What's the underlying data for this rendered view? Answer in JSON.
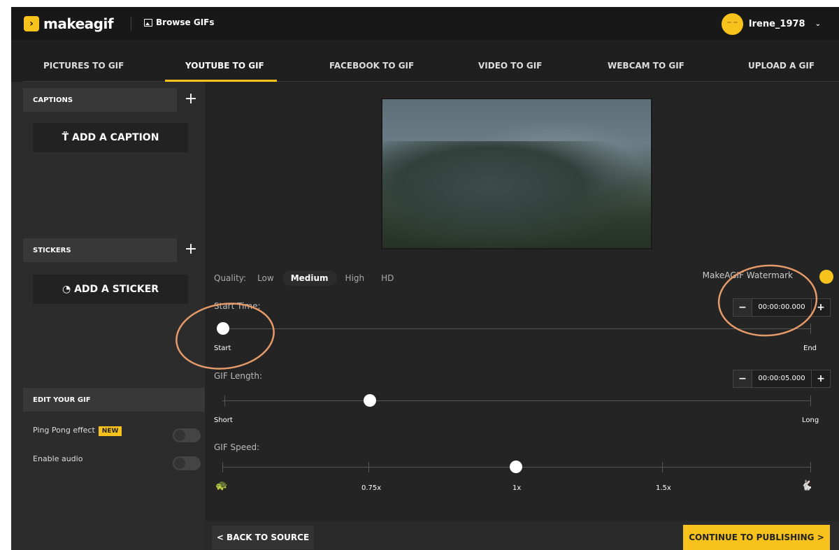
{
  "header": {
    "logo_text": "makeagif",
    "browse_label": "Browse GIFs",
    "username": "Irene_1978",
    "user_chevron": "⌄"
  },
  "tabs": [
    {
      "label": "PICTURES TO GIF"
    },
    {
      "label": "YOUTUBE TO GIF"
    },
    {
      "label": "FACEBOOK TO GIF"
    },
    {
      "label": "VIDEO TO GIF"
    },
    {
      "label": "WEBCAM TO GIF"
    },
    {
      "label": "UPLOAD A GIF"
    }
  ],
  "active_tab": "YOUTUBE TO GIF",
  "sidebar": {
    "captions_title": "CAPTIONS",
    "add_caption": "ADD A CAPTION",
    "stickers_title": "STICKERS",
    "add_sticker": "ADD A STICKER",
    "edit_title": "EDIT YOUR GIF",
    "ping_pong_label": "Ping Pong effect",
    "new_badge": "NEW",
    "audio_label": "Enable audio",
    "plus": "+"
  },
  "quality": {
    "label": "Quality:",
    "options": [
      "Low",
      "Medium",
      "High",
      "HD"
    ],
    "selected": "Medium"
  },
  "watermark_label": "MakeAGIF Watermark",
  "start_time": {
    "label": "Start Time:",
    "value": "00:00:00.000",
    "left_label": "Start",
    "right_label": "End",
    "position": 0
  },
  "gif_length": {
    "label": "GIF Length:",
    "value": "00:00:05.000",
    "left_label": "Short",
    "right_label": "Long"
  },
  "gif_speed": {
    "label": "GIF Speed:",
    "marks": [
      "0.75x",
      "1x",
      "1.5x"
    ],
    "selected": "1x"
  },
  "buttons": {
    "back": "< BACK TO SOURCE",
    "continue": "CONTINUE TO PUBLISHING >",
    "minus": "−",
    "plus": "+"
  },
  "colors": {
    "accent": "#f6c21b",
    "background": "#242424",
    "annotation": "#e59a6a"
  }
}
